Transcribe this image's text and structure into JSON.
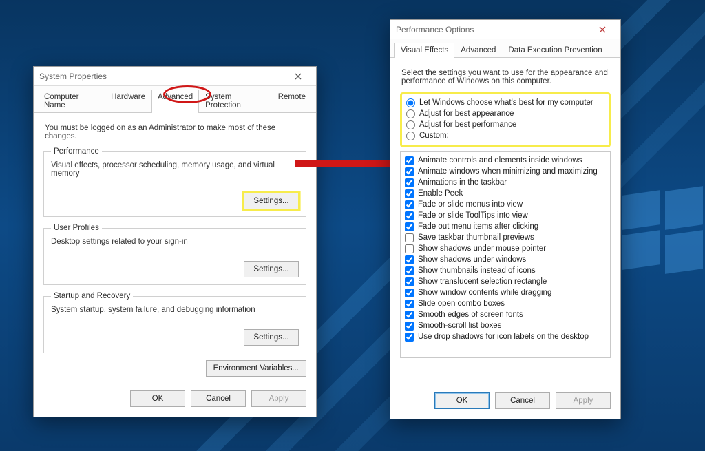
{
  "sysProps": {
    "title": "System Properties",
    "tabs": [
      "Computer Name",
      "Hardware",
      "Advanced",
      "System Protection",
      "Remote"
    ],
    "activeTab": "Advanced",
    "info": "You must be logged on as an Administrator to make most of these changes.",
    "sections": {
      "performance": {
        "legend": "Performance",
        "desc": "Visual effects, processor scheduling, memory usage, and virtual memory",
        "button": "Settings..."
      },
      "userProfiles": {
        "legend": "User Profiles",
        "desc": "Desktop settings related to your sign-in",
        "button": "Settings..."
      },
      "startup": {
        "legend": "Startup and Recovery",
        "desc": "System startup, system failure, and debugging information",
        "button": "Settings..."
      }
    },
    "envVars": "Environment Variables...",
    "buttons": {
      "ok": "OK",
      "cancel": "Cancel",
      "apply": "Apply"
    }
  },
  "perfOpts": {
    "title": "Performance Options",
    "tabs": [
      "Visual Effects",
      "Advanced",
      "Data Execution Prevention"
    ],
    "activeTab": "Visual Effects",
    "info": "Select the settings you want to use for the appearance and performance of Windows on this computer.",
    "radios": [
      {
        "label": "Let Windows choose what's best for my computer",
        "checked": true
      },
      {
        "label": "Adjust for best appearance",
        "checked": false
      },
      {
        "label": "Adjust for best performance",
        "checked": false
      },
      {
        "label": "Custom:",
        "checked": false
      }
    ],
    "options": [
      {
        "label": "Animate controls and elements inside windows",
        "checked": true
      },
      {
        "label": "Animate windows when minimizing and maximizing",
        "checked": true
      },
      {
        "label": "Animations in the taskbar",
        "checked": true
      },
      {
        "label": "Enable Peek",
        "checked": true
      },
      {
        "label": "Fade or slide menus into view",
        "checked": true
      },
      {
        "label": "Fade or slide ToolTips into view",
        "checked": true
      },
      {
        "label": "Fade out menu items after clicking",
        "checked": true
      },
      {
        "label": "Save taskbar thumbnail previews",
        "checked": false
      },
      {
        "label": "Show shadows under mouse pointer",
        "checked": false
      },
      {
        "label": "Show shadows under windows",
        "checked": true
      },
      {
        "label": "Show thumbnails instead of icons",
        "checked": true
      },
      {
        "label": "Show translucent selection rectangle",
        "checked": true
      },
      {
        "label": "Show window contents while dragging",
        "checked": true
      },
      {
        "label": "Slide open combo boxes",
        "checked": true
      },
      {
        "label": "Smooth edges of screen fonts",
        "checked": true
      },
      {
        "label": "Smooth-scroll list boxes",
        "checked": true
      },
      {
        "label": "Use drop shadows for icon labels on the desktop",
        "checked": true
      }
    ],
    "buttons": {
      "ok": "OK",
      "cancel": "Cancel",
      "apply": "Apply"
    }
  }
}
